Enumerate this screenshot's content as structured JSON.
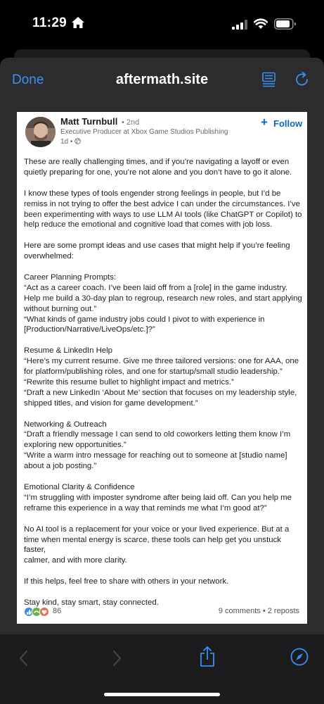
{
  "status_bar": {
    "time": "11:29"
  },
  "nav": {
    "done_label": "Done",
    "site_title": "aftermath.site"
  },
  "post": {
    "author": "Matt Turnbull",
    "degree": "• 2nd",
    "headline": "Executive Producer at Xbox Game Studios Publishing",
    "time_ago": "1d •",
    "follow_label": "Follow",
    "paragraphs": [
      [
        "These are really challenging times, and if you’re navigating a layoff or even",
        "quietly preparing for one, you’re not alone and you don’t have to go it alone."
      ],
      [
        "I know these types of tools engender strong feelings in people, but I’d be",
        "remiss in not trying to offer the best advice I can under the circumstances. I’ve",
        "been experimenting with ways to use LLM AI tools (like ChatGPT or Copilot) to",
        "help reduce the emotional and cognitive load that comes with job loss."
      ],
      [
        "Here are some prompt ideas and use cases that might help if you’re feeling",
        "overwhelmed:"
      ],
      [
        "Career Planning Prompts:",
        "“Act as a career coach. I’ve been laid off from a [role] in the game industry.",
        "Help me build a 30-day plan to regroup, research new roles, and start applying",
        "without burning out.”",
        "“What kinds of game industry jobs could I pivot to with experience in",
        "[Production/Narrative/LiveOps/etc.]?”"
      ],
      [
        "Resume & LinkedIn Help",
        "“Here’s my current resume. Give me three tailored versions: one for AAA, one",
        "for platform/publishing roles, and one for startup/small studio leadership.”",
        "“Rewrite this resume bullet to highlight impact and metrics.”",
        "“Draft a new LinkedIn ‘About Me’ section that focuses on my leadership style,",
        "shipped titles, and vision for game development.”"
      ],
      [
        "Networking & Outreach",
        "“Draft a friendly message I can send to old coworkers letting them know I’m",
        "exploring new opportunities.”",
        "“Write a warm intro message for reaching out to someone at [studio name]",
        "about a job posting.”"
      ],
      [
        "Emotional Clarity & Confidence",
        "“I’m struggling with imposter syndrome after being laid off. Can you help me",
        "reframe this experience in a way that reminds me what I’m good at?”"
      ],
      [
        "No AI tool is a replacement for your voice or your lived experience. But at a",
        "time when mental energy is scarce, these tools can help get you unstuck faster,",
        "calmer, and with more clarity."
      ],
      [
        "If this helps, feel free to share with others in your network."
      ],
      [
        "Stay kind, stay smart, stay connected."
      ]
    ],
    "reaction_count": "86",
    "stats": "9 comments • 2 reposts"
  },
  "colors": {
    "link_blue": "#3a8ff5",
    "linkedin_blue": "#0a66c2",
    "sheet_bg": "#2c2c2e"
  },
  "icons": [
    "home-icon",
    "signal-icon",
    "wifi-icon",
    "battery-icon",
    "reader-icon",
    "reload-icon",
    "globe-icon",
    "back-icon",
    "forward-icon",
    "share-icon",
    "compass-icon"
  ]
}
